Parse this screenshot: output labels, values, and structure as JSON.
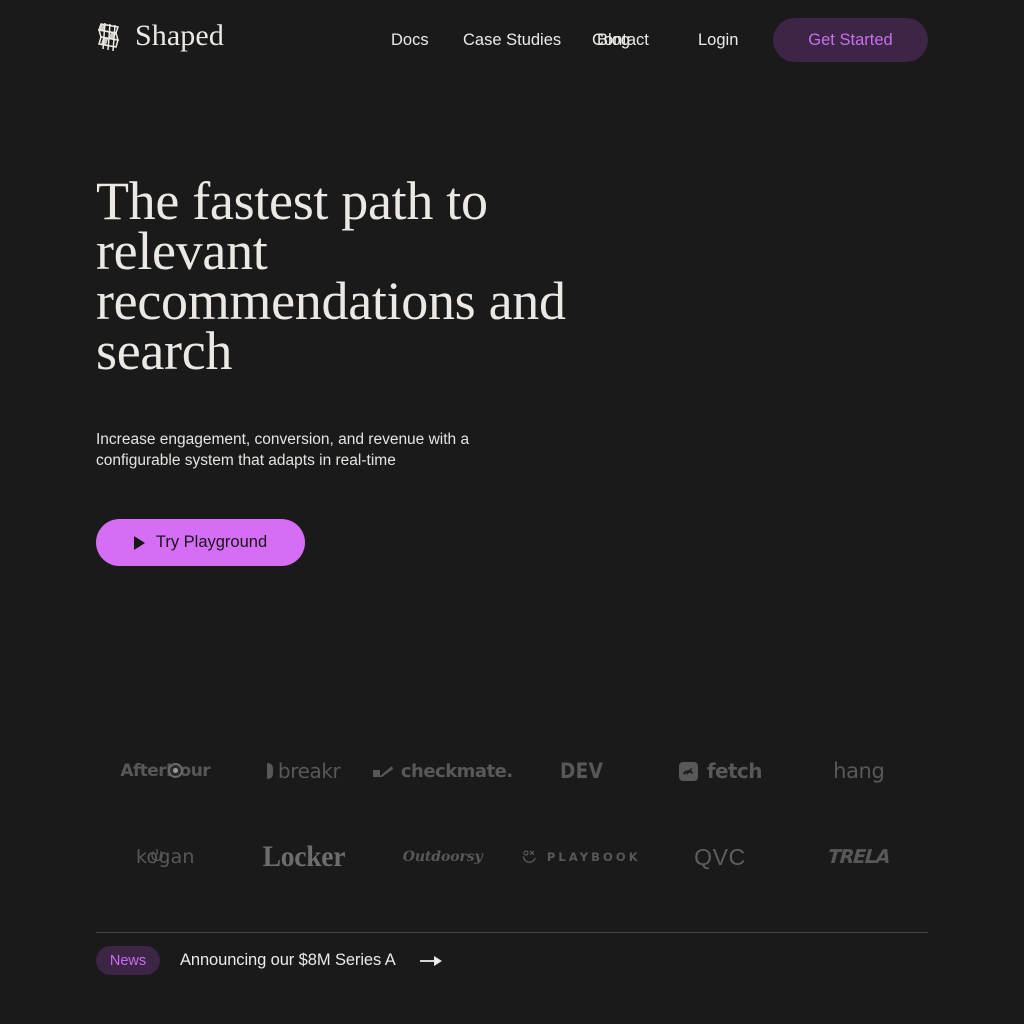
{
  "brand": {
    "name": "Shaped",
    "mark_icon": "shaped-mesh-logo-icon"
  },
  "nav": {
    "items": [
      {
        "label": "Docs",
        "name": "docs"
      },
      {
        "label": "Case Studies",
        "name": "case-studies"
      },
      {
        "label": "Blog",
        "name": "blog"
      },
      {
        "label": "Contact",
        "name": "contact"
      },
      {
        "label": "Login",
        "name": "login"
      }
    ],
    "cta_label": "Get Started"
  },
  "hero": {
    "title": "The fastest path to relevant recommendations and search",
    "subtitle": "Increase engagement, conversion, and revenue with a configurable system that adapts in real-time",
    "cta_label": "Try Playground",
    "cta_icon": "play-icon"
  },
  "logos": {
    "row1": [
      {
        "name": "afterhour",
        "text": "AfterHour"
      },
      {
        "name": "breakr",
        "text": "breakr"
      },
      {
        "name": "checkmate",
        "text": "checkmate."
      },
      {
        "name": "dev",
        "text": "DEV"
      },
      {
        "name": "fetch",
        "text": "fetch"
      },
      {
        "name": "hang",
        "text": "hang"
      }
    ],
    "row2": [
      {
        "name": "kogan",
        "text": "kogan"
      },
      {
        "name": "locker",
        "text": "Locker"
      },
      {
        "name": "outdoorsy",
        "text": "Outdoorsy"
      },
      {
        "name": "playbook",
        "text": "PLAYBOOK"
      },
      {
        "name": "qvc",
        "text": "QVC"
      },
      {
        "name": "trela",
        "text": "TRELA"
      }
    ]
  },
  "news": {
    "badge": "News",
    "headline": "Announcing our $8M Series A",
    "arrow_icon": "arrow-right-icon"
  },
  "colors": {
    "background": "#1a1a1a",
    "text_primary": "#ece9e4",
    "accent_purple": "#d66ef5",
    "accent_purple_text": "#c96ef0",
    "accent_purple_bg": "#3c2545",
    "logo_grey": "#585858",
    "divider": "#444442"
  }
}
